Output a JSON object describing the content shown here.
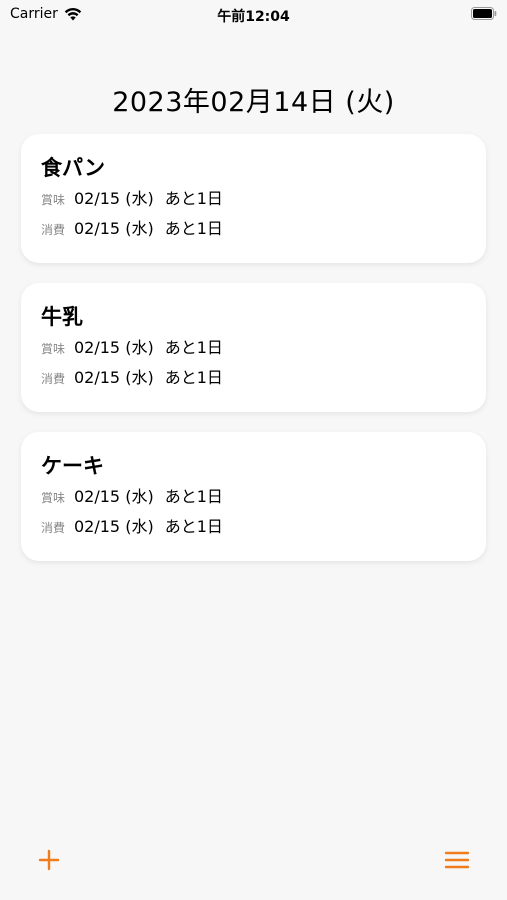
{
  "status_bar": {
    "carrier": "Carrier",
    "time": "午前12:04"
  },
  "header": {
    "date": "2023年02月14日 (火)"
  },
  "items": [
    {
      "name": "食パン",
      "best_before_label": "賞味",
      "best_before_date": "02/15 (水)",
      "best_before_remaining": "あと1日",
      "use_by_label": "消費",
      "use_by_date": "02/15 (水)",
      "use_by_remaining": "あと1日"
    },
    {
      "name": "牛乳",
      "best_before_label": "賞味",
      "best_before_date": "02/15 (水)",
      "best_before_remaining": "あと1日",
      "use_by_label": "消費",
      "use_by_date": "02/15 (水)",
      "use_by_remaining": "あと1日"
    },
    {
      "name": "ケーキ",
      "best_before_label": "賞味",
      "best_before_date": "02/15 (水)",
      "best_before_remaining": "あと1日",
      "use_by_label": "消費",
      "use_by_date": "02/15 (水)",
      "use_by_remaining": "あと1日"
    }
  ],
  "toolbar": {
    "add_icon": "plus-icon",
    "menu_icon": "hamburger-menu-icon",
    "accent_color": "#f07c1e"
  }
}
